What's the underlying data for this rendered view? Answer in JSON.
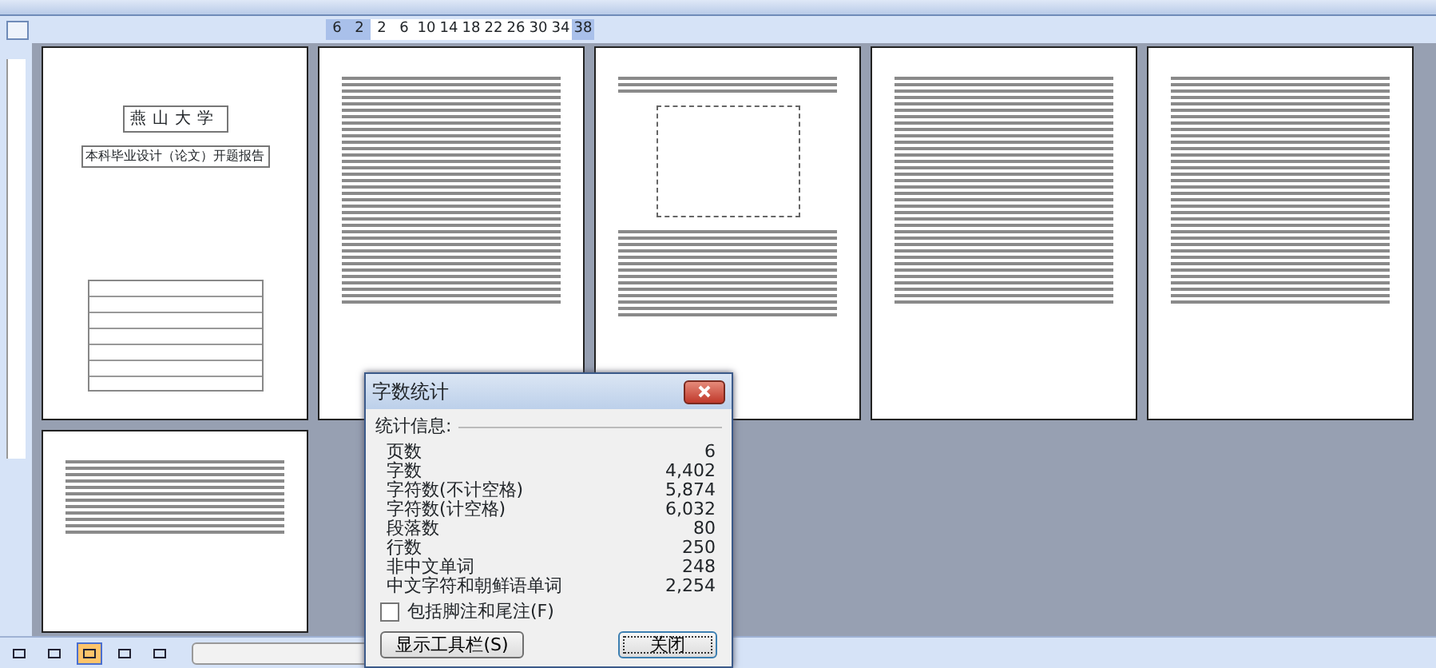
{
  "ruler": {
    "ticks": [
      "6",
      "2",
      "2",
      "6",
      "10",
      "14",
      "18",
      "22",
      "26",
      "30",
      "34",
      "38"
    ]
  },
  "pages": [
    {
      "kind": "cover",
      "title": "燕山大学",
      "subtitle": "本科毕业设计（论文）开题报告"
    },
    {
      "kind": "text"
    },
    {
      "kind": "diagram"
    },
    {
      "kind": "text"
    },
    {
      "kind": "text"
    },
    {
      "kind": "text"
    }
  ],
  "dialog": {
    "title": "字数统计",
    "section": "统计信息:",
    "stats": [
      {
        "label": "页数",
        "value": "6"
      },
      {
        "label": "字数",
        "value": "4,402"
      },
      {
        "label": "字符数(不计空格)",
        "value": "5,874"
      },
      {
        "label": "字符数(计空格)",
        "value": "6,032"
      },
      {
        "label": "段落数",
        "value": "80"
      },
      {
        "label": "行数",
        "value": "250"
      },
      {
        "label": "非中文单词",
        "value": "248"
      },
      {
        "label": "中文字符和朝鲜语单词",
        "value": "2,254"
      }
    ],
    "checkbox": {
      "label": "包括脚注和尾注(F)",
      "checked": false
    },
    "buttons": [
      {
        "label": "显示工具栏(S)",
        "kind": "secondary"
      },
      {
        "label": "关闭",
        "kind": "default"
      }
    ]
  },
  "status_bar": {
    "views": [
      {
        "selected": false
      },
      {
        "selected": false
      },
      {
        "selected": true
      },
      {
        "selected": false
      },
      {
        "selected": false
      }
    ]
  }
}
